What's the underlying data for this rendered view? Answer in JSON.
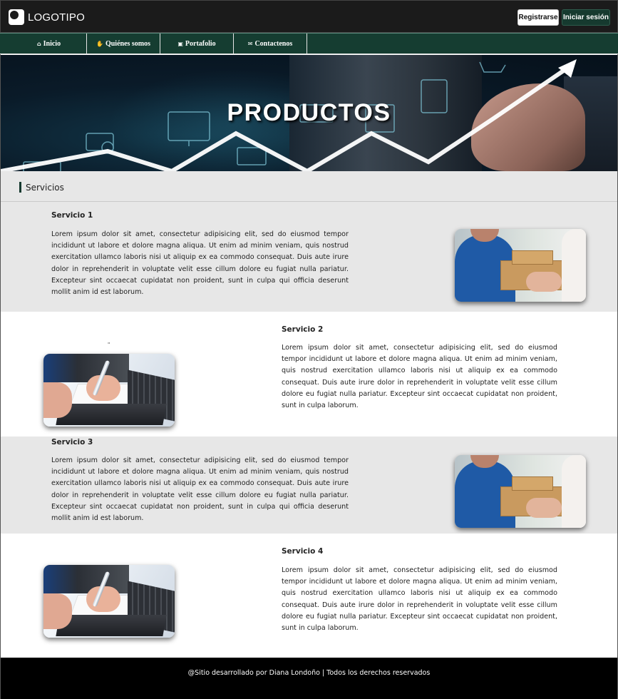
{
  "header": {
    "logo": {
      "part1": "LOGO",
      "part2": "TIPO"
    },
    "register_label": "Registrarse",
    "login_label": "Iniciar sesión"
  },
  "nav": {
    "items": [
      {
        "icon": "home-icon",
        "label": "Inicio"
      },
      {
        "icon": "handshake-icon",
        "label": "Quiénes somos"
      },
      {
        "icon": "briefcase-icon",
        "label": "Portafolio"
      },
      {
        "icon": "envelope-icon",
        "label": "Contactenos"
      }
    ]
  },
  "banner": {
    "title": "PRODUCTOS"
  },
  "section": {
    "title": "Servicios"
  },
  "services": [
    {
      "title": "Servicio 1",
      "text": "Lorem ipsum dolor sit amet, consectetur adipisicing elit, sed do eiusmod tempor incididunt ut labore et dolore magna aliqua. Ut enim ad minim veniam, quis nostrud exercitation ullamco laboris nisi ut aliquip ex ea commodo consequat. Duis aute irure dolor in reprehenderit in voluptate velit esse cillum dolore eu fugiat nulla pariatur. Excepteur sint occaecat cupidatat non proident, sunt in culpa qui officia deserunt mollit anim id est laborum."
    },
    {
      "title": "Servicio 2",
      "text": "Lorem ipsum dolor sit amet, consectetur adipisicing elit, sed do eiusmod tempor incididunt ut labore et dolore magna aliqua. Ut enim ad minim veniam, quis nostrud exercitation ullamco laboris nisi ut aliquip ex ea commodo consequat. Duis aute irure dolor in reprehenderit in voluptate velit esse cillum dolore eu fugiat nulla pariatur. Excepteur sint occaecat cupidatat non proident, sunt in culpa laborum.",
      "mark": "\""
    },
    {
      "title": "Servicio 3",
      "text": "Lorem ipsum dolor sit amet, consectetur adipisicing elit, sed do eiusmod tempor incididunt ut labore et dolore magna aliqua. Ut enim ad minim veniam, quis nostrud exercitation ullamco laboris nisi ut aliquip ex ea commodo consequat. Duis aute irure dolor in reprehenderit in voluptate velit esse cillum dolore eu fugiat nulla pariatur. Excepteur sint occaecat cupidatat non proident, sunt in culpa qui officia deserunt mollit anim id est laborum."
    },
    {
      "title": "Servicio 4",
      "text": "Lorem ipsum dolor sit amet, consectetur adipisicing elit, sed do eiusmod tempor incididunt ut labore et dolore magna aliqua. Ut enim ad minim veniam, quis nostrud exercitation ullamco laboris nisi ut aliquip ex ea commodo consequat. Duis aute irure dolor in reprehenderit in voluptate velit esse cillum dolore eu fugiat nulla pariatur. Excepteur sint occaecat cupidatat non proident, sunt in culpa laborum."
    }
  ],
  "footer": {
    "text": "@Sitio desarrollado por Diana Londoño | Todos los derechos reservados"
  },
  "colors": {
    "brand": "#163a2f",
    "header_bg": "#1b1b1b",
    "section_bg": "#e7e7e7",
    "footer_bg": "#000000"
  }
}
